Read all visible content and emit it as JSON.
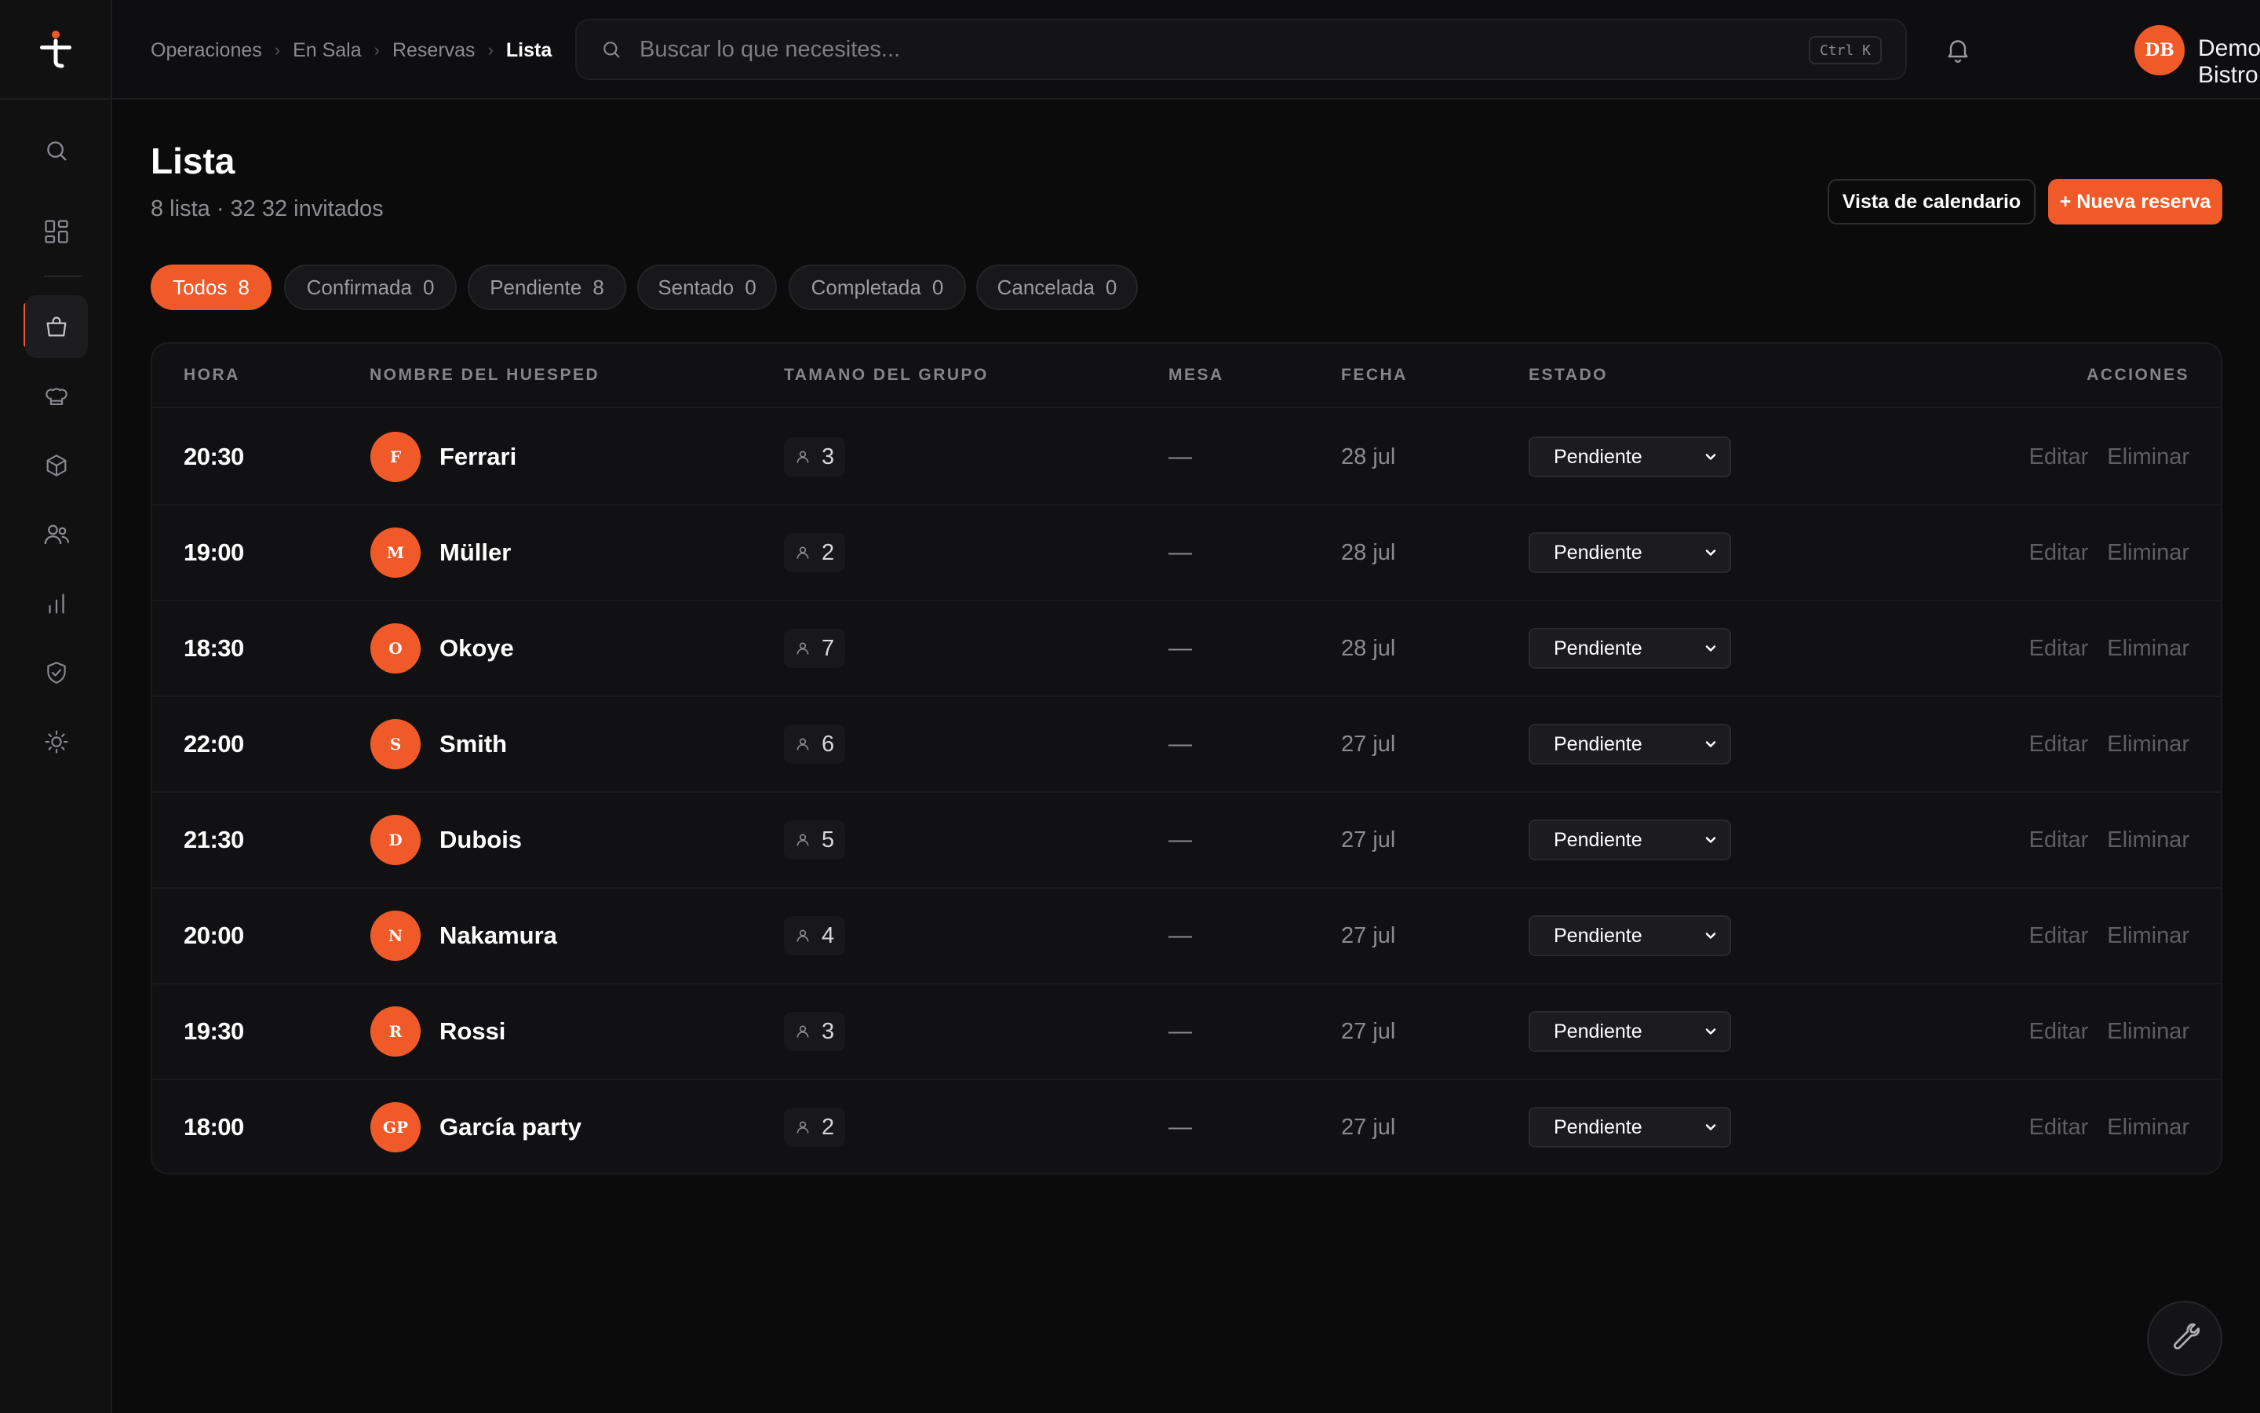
{
  "header": {
    "breadcrumb": [
      "Operaciones",
      "En Sala",
      "Reservas",
      "Lista"
    ],
    "search_placeholder": "Buscar lo que necesites...",
    "search_shortcut": "Ctrl K",
    "user_initials": "DB",
    "user_name": "Demo Bistro"
  },
  "sidebar": {
    "items": [
      {
        "icon": "search-icon"
      },
      {
        "icon": "dashboard-icon"
      },
      {
        "icon": "shopping-bag-icon",
        "active": true
      },
      {
        "icon": "chef-hat-icon"
      },
      {
        "icon": "box-icon"
      },
      {
        "icon": "users-icon"
      },
      {
        "icon": "bar-chart-icon"
      },
      {
        "icon": "shield-check-icon"
      },
      {
        "icon": "sun-icon"
      }
    ]
  },
  "page": {
    "title": "Lista",
    "subtitle": "8 lista · 32 32 invitados",
    "calendar_button": "Vista de calendario",
    "new_button": "+ Nueva reserva"
  },
  "filters": [
    {
      "label": "Todos",
      "count": "8",
      "active": true
    },
    {
      "label": "Confirmada",
      "count": "0"
    },
    {
      "label": "Pendiente",
      "count": "8"
    },
    {
      "label": "Sentado",
      "count": "0"
    },
    {
      "label": "Completada",
      "count": "0"
    },
    {
      "label": "Cancelada",
      "count": "0"
    }
  ],
  "table": {
    "columns": [
      "HORA",
      "NOMBRE DEL HUESPED",
      "TAMANO DEL GRUPO",
      "MESA",
      "FECHA",
      "ESTADO",
      "ACCIONES"
    ],
    "edit_label": "Editar",
    "delete_label": "Eliminar",
    "rows": [
      {
        "time": "20:30",
        "initials": "F",
        "name": "Ferrari",
        "party": "3",
        "table": "—",
        "date": "28 jul",
        "status": "Pendiente"
      },
      {
        "time": "19:00",
        "initials": "M",
        "name": "Müller",
        "party": "2",
        "table": "—",
        "date": "28 jul",
        "status": "Pendiente"
      },
      {
        "time": "18:30",
        "initials": "O",
        "name": "Okoye",
        "party": "7",
        "table": "—",
        "date": "28 jul",
        "status": "Pendiente"
      },
      {
        "time": "22:00",
        "initials": "S",
        "name": "Smith",
        "party": "6",
        "table": "—",
        "date": "27 jul",
        "status": "Pendiente"
      },
      {
        "time": "21:30",
        "initials": "D",
        "name": "Dubois",
        "party": "5",
        "table": "—",
        "date": "27 jul",
        "status": "Pendiente"
      },
      {
        "time": "20:00",
        "initials": "N",
        "name": "Nakamura",
        "party": "4",
        "table": "—",
        "date": "27 jul",
        "status": "Pendiente"
      },
      {
        "time": "19:30",
        "initials": "R",
        "name": "Rossi",
        "party": "3",
        "table": "—",
        "date": "27 jul",
        "status": "Pendiente"
      },
      {
        "time": "18:00",
        "initials": "GP",
        "name": "García party",
        "party": "2",
        "table": "—",
        "date": "27 jul",
        "status": "Pendiente"
      }
    ]
  },
  "colors": {
    "accent": "#f05a28",
    "background": "#0b0b0c",
    "surface": "#111113"
  },
  "fab_icon": "wrench-icon"
}
